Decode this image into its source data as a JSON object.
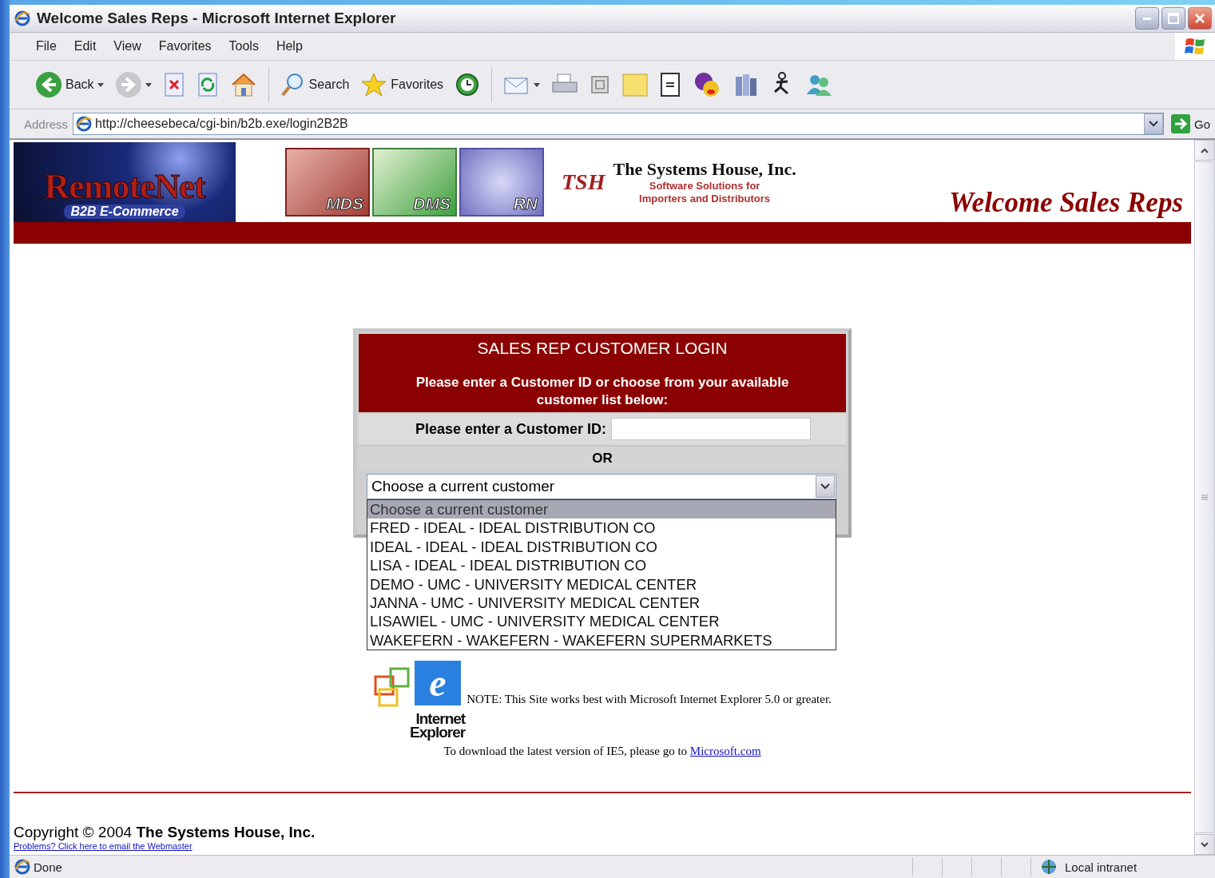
{
  "window": {
    "title": "Welcome Sales Reps - Microsoft Internet Explorer"
  },
  "menu": [
    "File",
    "Edit",
    "View",
    "Favorites",
    "Tools",
    "Help"
  ],
  "toolbar": {
    "back": "Back",
    "search": "Search",
    "favorites": "Favorites"
  },
  "address_bar": {
    "label": "Address",
    "url": "http://cheesebeca/cgi-bin/b2b.exe/login2B2B",
    "go": "Go"
  },
  "banner": {
    "logo_title": "RemoteNet",
    "logo_subtitle": "B2B E-Commerce",
    "tiles": [
      "MDS",
      "DMS",
      "RN"
    ],
    "monogram": "TSH",
    "company": "The Systems House, Inc.",
    "tagline_1": "Software Solutions for",
    "tagline_2": "Importers and Distributors",
    "page_heading": "Welcome Sales Reps"
  },
  "login": {
    "title": "SALES REP CUSTOMER LOGIN",
    "instructions": "Please enter a Customer ID or choose from your available customer list below:",
    "id_label": "Please enter a Customer ID:",
    "separator": "OR",
    "select": {
      "value": "Choose a current customer",
      "expanded": true,
      "options": [
        {
          "label": "Choose a current customer",
          "selected": true
        },
        {
          "label": "FRED - IDEAL - IDEAL DISTRIBUTION CO",
          "selected": false
        },
        {
          "label": "IDEAL - IDEAL - IDEAL DISTRIBUTION CO",
          "selected": false
        },
        {
          "label": "LISA - IDEAL - IDEAL DISTRIBUTION CO",
          "selected": false
        },
        {
          "label": "DEMO - UMC - UNIVERSITY MEDICAL CENTER",
          "selected": false
        },
        {
          "label": "JANNA - UMC - UNIVERSITY MEDICAL CENTER",
          "selected": false
        },
        {
          "label": "LISAWIEL - UMC - UNIVERSITY MEDICAL CENTER",
          "selected": false
        },
        {
          "label": "WAKEFERN - WAKEFERN - WAKEFERN SUPERMARKETS",
          "selected": false
        }
      ]
    }
  },
  "note": {
    "logo_letter": "e",
    "logo_word_1": "Internet",
    "logo_word_2": "Explorer",
    "text": "NOTE: This Site works best with Microsoft Internet Explorer 5.0 or greater.",
    "download_text": "To download the latest version of IE5, please go to",
    "download_link": "Microsoft.com"
  },
  "footer": {
    "copyright": "Copyright © 2004 **The Systems House, Inc.**",
    "problems": "Problems? Click here to email the Webmaster"
  },
  "status_bar": {
    "text": "Done",
    "zone": "Local intranet"
  }
}
